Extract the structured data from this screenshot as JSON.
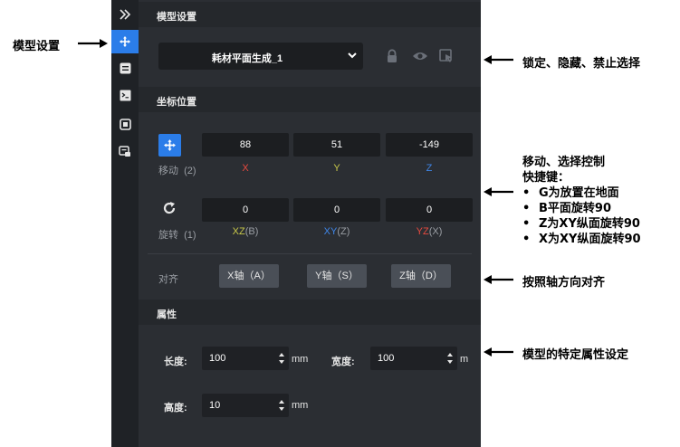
{
  "sections": {
    "model_settings": "模型设置",
    "position": "坐标位置",
    "properties": "属性"
  },
  "model_dropdown": {
    "value": "耗材平面生成_1"
  },
  "move": {
    "label": "移动",
    "shortcut": "(2)",
    "x": "88",
    "y": "51",
    "z": "-149",
    "x_axis": "X",
    "y_axis": "Y",
    "z_axis": "Z"
  },
  "rotate": {
    "label": "旋转",
    "shortcut": "(1)",
    "xz": "0",
    "xy": "0",
    "yz": "0",
    "xz_axis": "XZ",
    "xz_key": "(B)",
    "xy_axis": "XY",
    "xy_key": "(Z)",
    "yz_axis": "YZ",
    "yz_key": "(X)"
  },
  "align": {
    "label": "对齐",
    "x_btn": "X轴（A）",
    "y_btn": "Y轴（S）",
    "z_btn": "Z轴（D）"
  },
  "dimensions": {
    "length_label": "长度:",
    "length_value": "100",
    "width_label": "宽度:",
    "width_value": "100",
    "height_label": "高度:",
    "height_value": "10",
    "unit": "mm",
    "unit_clipped": "m"
  },
  "annotations": {
    "model_settings": "模型设置",
    "lock_hide": "锁定、隐藏、禁止选择",
    "move_select_1": "移动、选择控制",
    "move_select_2": "快捷键：",
    "shortcuts": [
      "G为放置在地面",
      "B平面旋转90",
      "Z为XY纵面旋转90",
      "X为XY纵面旋转90"
    ],
    "bullet": "•",
    "align_axis": "按照轴方向对齐",
    "model_props": "模型的特定属性设定"
  },
  "colors": {
    "x_axis": "#e84a3f",
    "y_axis": "#c9c94a",
    "z_axis": "#3f86e8",
    "accent": "#2b7de9"
  }
}
